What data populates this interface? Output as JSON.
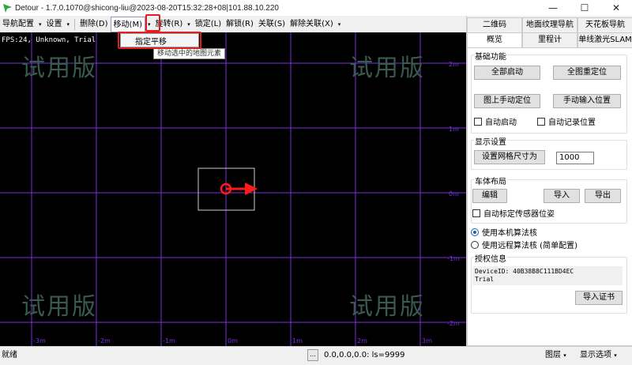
{
  "window": {
    "title": "Detour - 1.7.0.1070@shicong-liu@2023-08-20T15:32:28+08|101.88.10.220",
    "minimize": "—",
    "maximize": "☐",
    "close": "✕"
  },
  "menu": {
    "items": [
      "导航配置",
      "设置",
      "删除(D)",
      "移动(M)",
      "旋转(R)",
      "锁定(L)",
      "解锁(R)",
      "关联(S)",
      "解除关联(X)"
    ],
    "arrow": "▾",
    "popup_item": "指定平移",
    "tooltip": "移动选中的地图元素"
  },
  "canvas": {
    "fps": "FPS:24, Unknown, Trial",
    "watermark": "试用版",
    "grid_color": "#7b2fe0",
    "x_ticks": [
      "-3m",
      "-2m",
      "-1m",
      "0m",
      "1m",
      "2m",
      "3m"
    ],
    "y_ticks": [
      "2m",
      "1m",
      "0m",
      "-1m",
      "-2m"
    ]
  },
  "panel": {
    "tabs_row1": [
      "二维码",
      "地面纹理导航",
      "天花板导航"
    ],
    "tabs_row2": [
      "概览",
      "里程计",
      "单线激光SLAM"
    ],
    "basic": {
      "label": "基础功能",
      "start_all": "全部启动",
      "relocate_all": "全图重定位",
      "manual_locate": "图上手动定位",
      "manual_input": "手动输入位置",
      "auto_start": "自动启动",
      "auto_record": "自动记录位置"
    },
    "display": {
      "label": "显示设置",
      "grid_size_btn": "设置网格尺寸为",
      "grid_size_value": "1000"
    },
    "layout": {
      "label": "车体布局",
      "edit": "编辑",
      "import": "导入",
      "export": "导出",
      "auto_calib": "自动标定传感器位姿"
    },
    "algo": {
      "local": "使用本机算法核",
      "remote": "使用远程算法核 (简单配置)"
    },
    "license": {
      "label": "授权信息",
      "device_id": "DeviceID: 40B38B8C111BD4EC",
      "type": "Trial",
      "import_cert": "导入证书"
    }
  },
  "status": {
    "left": "就绪",
    "btn": "...",
    "coords": "0.0,0.0,0.0: ls=9999",
    "layers": "图层",
    "display_opts": "显示选项"
  }
}
